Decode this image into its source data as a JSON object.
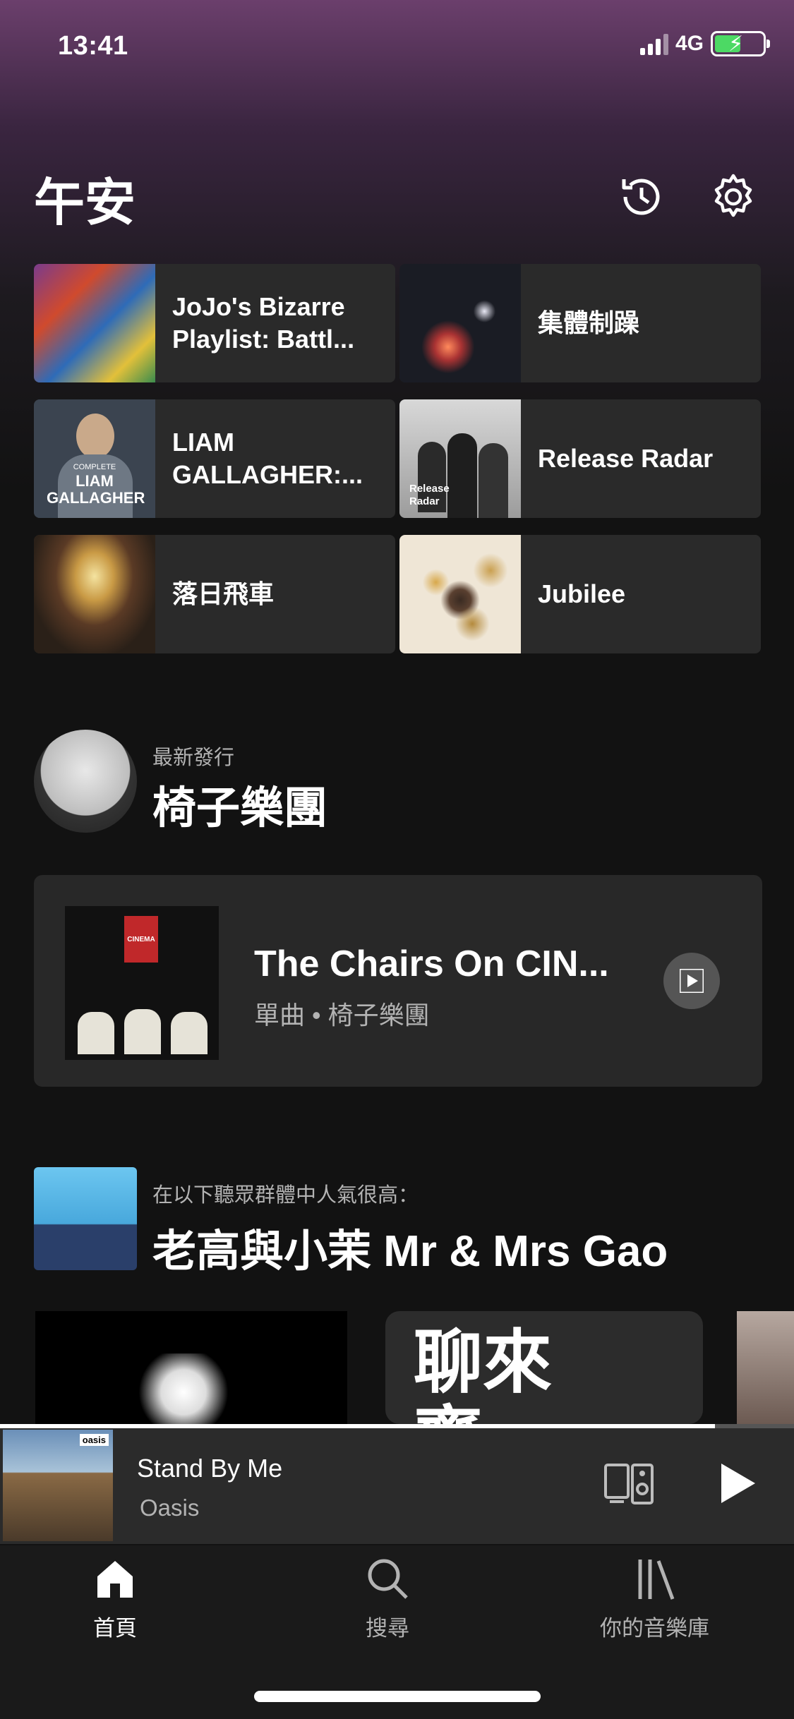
{
  "status_bar": {
    "time": "13:41",
    "network": "4G"
  },
  "header": {
    "greeting": "午安"
  },
  "shortcuts": [
    {
      "label": "JoJo's Bizarre Playlist: Battl..."
    },
    {
      "label": "集體制躁"
    },
    {
      "label": "LIAM GALLAGHER:..."
    },
    {
      "label": "Release Radar"
    },
    {
      "label": "落日飛車"
    },
    {
      "label": "Jubilee"
    }
  ],
  "art_text": {
    "liam": "LIAM GALLAGHER",
    "liam_top": "COMPLETE",
    "release_radar": "Release Radar",
    "cinema": "CINEMA"
  },
  "new_release": {
    "subtitle": "最新發行",
    "artist": "椅子樂團",
    "title": "The Chairs On CIN...",
    "type": "單曲",
    "separator": "•",
    "card_artist": "椅子樂團"
  },
  "popular": {
    "subtitle": "在以下聽眾群體中人氣很高：",
    "title": "老高與小茉 Mr & Mrs Gao"
  },
  "carousel": {
    "chat_line1": "聊來",
    "chat_line2": "齋"
  },
  "now_playing": {
    "title": "Stand By Me",
    "artist": "Oasis",
    "progress": 0.9,
    "album_label": "oasis"
  },
  "nav": {
    "home": "首頁",
    "search": "搜尋",
    "library": "你的音樂庫"
  },
  "colors": {
    "background": "#121212",
    "card": "#282828",
    "secondary_text": "#b3b3b3",
    "battery_fill": "#4cd964"
  }
}
